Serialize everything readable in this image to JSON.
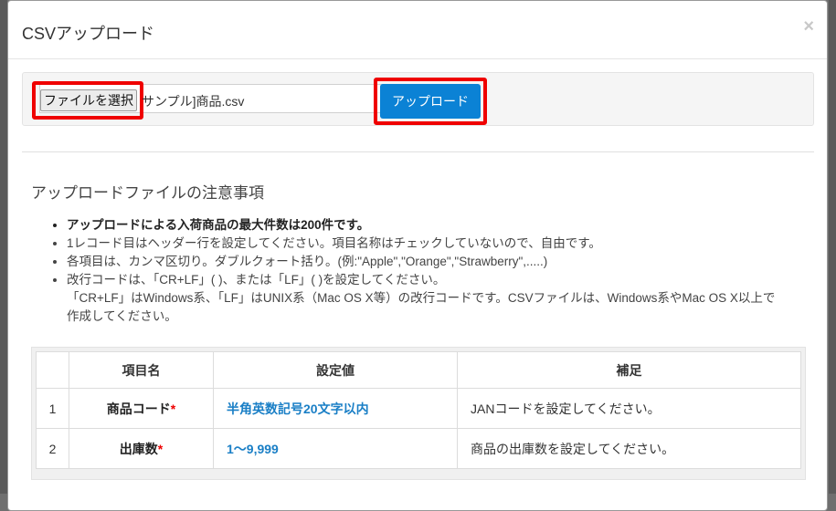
{
  "modal": {
    "title": "CSVアップロード",
    "close_label": "×"
  },
  "upload": {
    "choose_label": "ファイルを選択",
    "file_name": "サンプル]商品.csv",
    "upload_label": "アップロード"
  },
  "notes": {
    "heading": "アップロードファイルの注意事項",
    "items": [
      "アップロードによる入荷商品の最大件数は200件です。",
      "1レコード目はヘッダー行を設定してください。項目名称はチェックしていないので、自由です。",
      "各項目は、カンマ区切り。ダブルクォート括り。(例:\"Apple\",\"Orange\",\"Strawberry\",.....)",
      "改行コードは、「CR+LF」( )、または「LF」( )を設定してください。"
    ],
    "item4_cont1": "「CR+LF」はWindows系、「LF」はUNIX系（Mac OS X等）の改行コードです。CSVファイルは、Windows系やMac OS X以上で",
    "item4_cont2": "作成してください。"
  },
  "table": {
    "headers": [
      "",
      "項目名",
      "設定値",
      "補足"
    ],
    "rows": [
      {
        "num": "1",
        "item": "商品コード",
        "required": "*",
        "setting": "半角英数記号20文字以内",
        "note": "JANコードを設定してください。"
      },
      {
        "num": "2",
        "item": "出庫数",
        "required": "*",
        "setting": "1〜9,999",
        "note": "商品の出庫数を設定してください。"
      }
    ]
  },
  "colors": {
    "accent": "#0b82d5",
    "highlight": "#ef0000",
    "required": "#ee0000",
    "setting_text": "#1a7fc6"
  }
}
